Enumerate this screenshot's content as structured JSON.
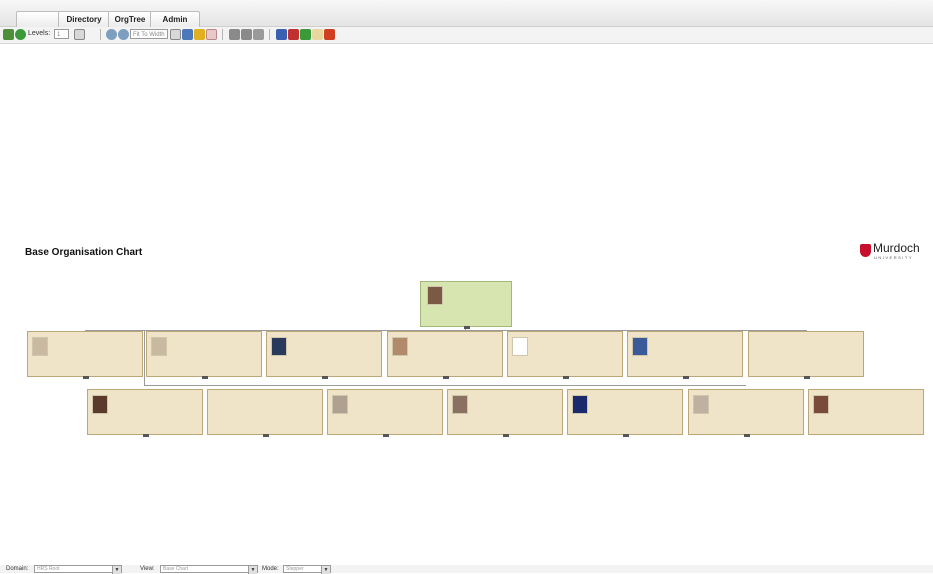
{
  "tabs": [
    {
      "label": ""
    },
    {
      "label": "Directory"
    },
    {
      "label": "OrgTree"
    },
    {
      "label": "Admin"
    }
  ],
  "toolbar": {
    "levels_label": "Levels:",
    "levels_value": "1",
    "fit_value": "Fit To Width"
  },
  "chart": {
    "title": "Base Organisation Chart",
    "logo_word": "Murdoch",
    "logo_sub": "UNIVERSITY"
  },
  "statusbar": {
    "domain_label": "Domain:",
    "domain_value": "HRS Root",
    "view_label": "View:",
    "view_value": "Base Chart",
    "mode_label": "Mode:",
    "mode_value": "Stepper"
  },
  "colors": {
    "card_fill": "#efe4c8",
    "root_fill": "#d7e5b0",
    "logo_red": "#c8102e"
  }
}
